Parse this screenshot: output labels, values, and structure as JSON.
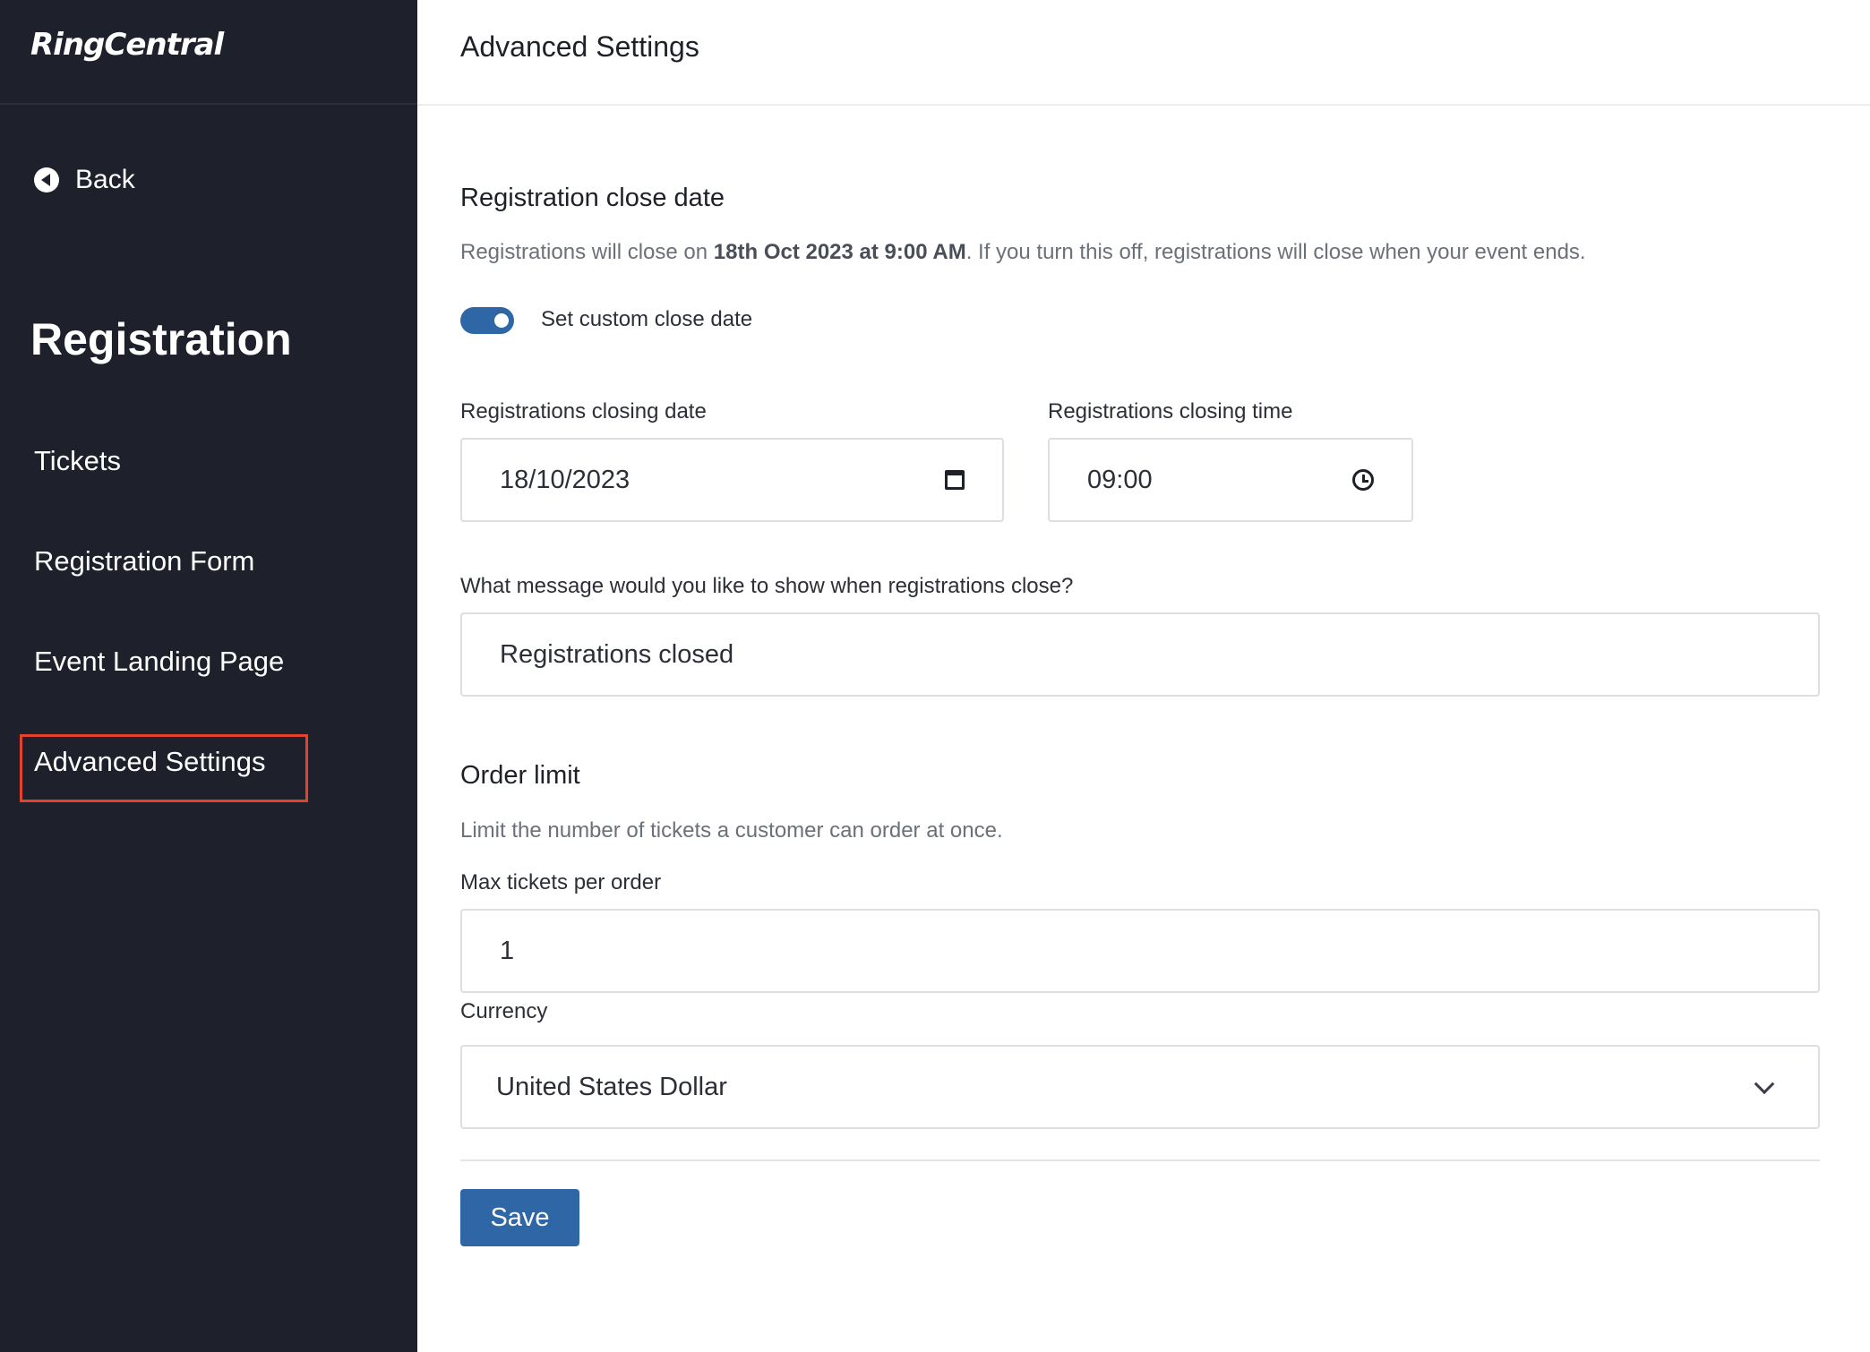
{
  "sidebar": {
    "logo": "RingCentral",
    "back_label": "Back",
    "section_title": "Registration",
    "items": [
      {
        "label": "Tickets"
      },
      {
        "label": "Registration Form"
      },
      {
        "label": "Event Landing Page"
      },
      {
        "label": "Advanced Settings",
        "active": true
      }
    ]
  },
  "header": {
    "title": "Advanced Settings"
  },
  "close_date": {
    "heading": "Registration close date",
    "desc_prefix": "Registrations will close on ",
    "desc_bold": "18th Oct 2023 at 9:00 AM",
    "desc_suffix": ". If you turn this off, registrations will close when your event ends.",
    "toggle_label": "Set custom close date",
    "toggle_on": true,
    "date_label": "Registrations closing date",
    "date_value": "18/10/2023",
    "time_label": "Registrations closing time",
    "time_value": "09:00",
    "message_label": "What message would you like to show when registrations close?",
    "message_value": "Registrations closed"
  },
  "order_limit": {
    "heading": "Order limit",
    "desc": "Limit the number of tickets a customer can order at once.",
    "max_label": "Max tickets per order",
    "max_value": "1",
    "currency_label": "Currency",
    "currency_value": "United States Dollar"
  },
  "save_label": "Save",
  "colors": {
    "sidebar_bg": "#1e202b",
    "accent": "#2f66a6",
    "highlight_border": "#e3432d"
  },
  "icons": [
    "back-circle-icon",
    "calendar-icon",
    "clock-icon",
    "chevron-down-icon"
  ]
}
